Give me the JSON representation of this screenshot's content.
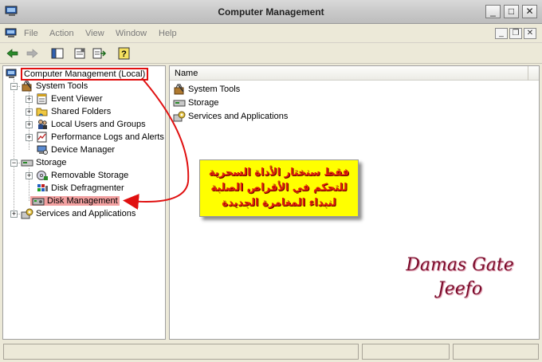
{
  "window": {
    "title": "Computer Management",
    "minimize": "_",
    "maximize": "□",
    "close": "✕"
  },
  "menu": {
    "items": [
      "File",
      "Action",
      "View",
      "Window",
      "Help"
    ],
    "mdi_min": "_",
    "mdi_restore": "❐",
    "mdi_close": "✕"
  },
  "toolbar": {
    "icons": [
      "back-arrow-icon",
      "forward-arrow-icon",
      "show-hide-tree-icon",
      "properties-icon",
      "export-list-icon",
      "help-icon"
    ]
  },
  "tree": {
    "root": "Computer Management (Local)",
    "items": [
      {
        "label": "System Tools",
        "icon": "tools-icon"
      },
      {
        "label": "Event Viewer",
        "icon": "event-viewer-icon"
      },
      {
        "label": "Shared Folders",
        "icon": "shared-folders-icon"
      },
      {
        "label": "Local Users and Groups",
        "icon": "users-icon"
      },
      {
        "label": "Performance Logs and Alerts",
        "icon": "performance-icon"
      },
      {
        "label": "Device Manager",
        "icon": "device-manager-icon"
      },
      {
        "label": "Storage",
        "icon": "storage-icon"
      },
      {
        "label": "Removable Storage",
        "icon": "removable-storage-icon"
      },
      {
        "label": "Disk Defragmenter",
        "icon": "defrag-icon"
      },
      {
        "label": "Disk Management",
        "icon": "disk-management-icon"
      },
      {
        "label": "Services and Applications",
        "icon": "services-icon"
      }
    ],
    "expand_plus": "+",
    "expand_minus": "−"
  },
  "list": {
    "column_name": "Name",
    "rows": [
      "System Tools",
      "Storage",
      "Services and Applications"
    ]
  },
  "callout": {
    "lines": [
      "فقط سنختار الأداة السحرية",
      "للتحكم في الأقراص الصلبة",
      "لنبداء المغامرة الجديدة"
    ],
    "background": "#ffff00",
    "text_color": "#e0200a"
  },
  "watermark": {
    "line1": "Damas Gate",
    "line2": "Jeefo"
  },
  "colors": {
    "highlight_border": "#e01010",
    "selected_bg": "#f2a0a0",
    "arrow": "#e01010"
  }
}
